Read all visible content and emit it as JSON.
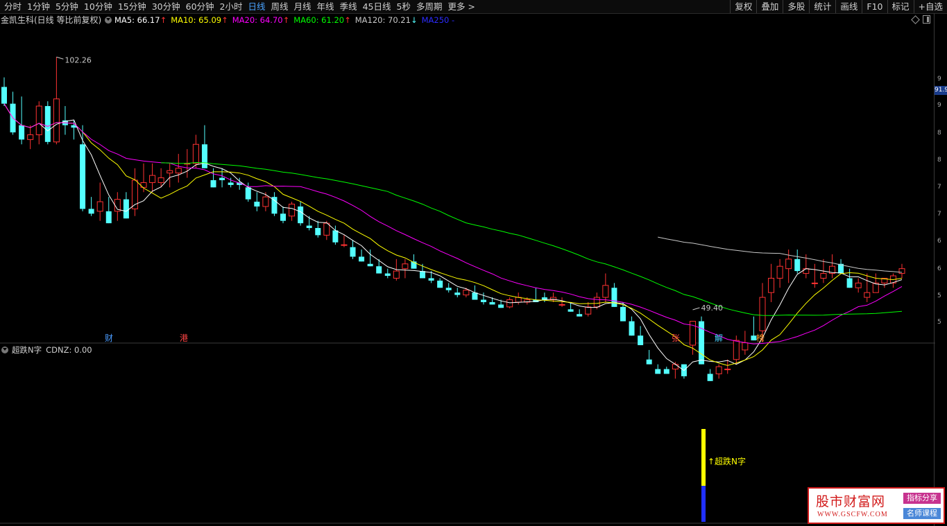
{
  "toolbar": {
    "periods": [
      "分时",
      "1分钟",
      "5分钟",
      "10分钟",
      "15分钟",
      "30分钟",
      "60分钟",
      "2小时",
      "日线",
      "周线",
      "月线",
      "年线",
      "季线",
      "45日线",
      "5秒",
      "多周期",
      "更多 >"
    ],
    "active_period": "日线",
    "right_buttons": [
      "复权",
      "叠加",
      "多股",
      "统计",
      "画线",
      "F10",
      "标记",
      "+自选"
    ]
  },
  "main_legend": {
    "stock_name": "金凯生科(日线 等比前复权)",
    "ma5": "MA5: 66.17",
    "ma10": "MA10: 65.09",
    "ma20": "MA20: 64.70",
    "ma60": "MA60: 61.20",
    "ma120": "MA120: 70.21",
    "ma250": "MA250 -",
    "up_arrow": "↑",
    "down_arrow": "↓",
    "colors": {
      "ma5": "#ffffff",
      "ma10": "#ffff00",
      "ma20": "#ff00ff",
      "ma60": "#00ff00",
      "ma120": "#c8c8c8",
      "ma250": "#2c2cff",
      "up": "#ff3232",
      "down": "#54ffff"
    }
  },
  "annotations": {
    "high_label": "102.26",
    "low_label": "49.40",
    "markers": [
      {
        "text": "财",
        "color": "#4a9cff"
      },
      {
        "text": "港",
        "color": "#ff4444"
      },
      {
        "text": "张",
        "color": "#ff4444"
      },
      {
        "text": "解",
        "color": "#4ad2ff"
      },
      {
        "text": "榜",
        "color": "#ff9a2a"
      }
    ]
  },
  "axis": {
    "labels": [
      "9",
      "9",
      "8",
      "8",
      "7",
      "7",
      "6",
      "6",
      "5",
      "5"
    ],
    "current_price_tag": "91.9"
  },
  "indicator": {
    "name": "超跌N字",
    "value_text": "CDNZ: 0.00",
    "signal_label": "↑超跌N字"
  },
  "watermark": {
    "title": "股市财富网",
    "url": "WWW.GSCFW.COM",
    "tag1": "指标分享",
    "tag2": "名师课程"
  },
  "chart_data": {
    "type": "candlestick",
    "title": "金凯生科(日线 等比前复权)",
    "high": 102.26,
    "low": 49.4,
    "series_names": [
      "MA5",
      "MA10",
      "MA20",
      "MA60",
      "MA120",
      "MA250"
    ],
    "ma_values_latest": {
      "MA5": 66.17,
      "MA10": 65.09,
      "MA20": 64.7,
      "MA60": 61.2,
      "MA120": 70.21
    },
    "candles_ohlc_approx": [
      [
        96,
        98,
        92,
        92.5
      ],
      [
        92.5,
        95,
        86,
        86.5
      ],
      [
        88,
        94,
        84,
        85
      ],
      [
        85,
        88,
        83,
        86
      ],
      [
        86,
        93,
        84,
        92
      ],
      [
        92,
        93,
        84,
        84.5
      ],
      [
        84.5,
        102.26,
        84,
        93.5
      ],
      [
        89,
        92,
        86,
        88
      ],
      [
        88,
        89,
        85,
        87.5
      ],
      [
        84,
        88,
        70,
        70.5
      ],
      [
        70.5,
        73,
        69,
        69.5
      ],
      [
        70,
        76,
        68,
        72
      ],
      [
        70,
        73,
        67.5,
        67.5
      ],
      [
        70,
        74,
        68,
        72.5
      ],
      [
        72.5,
        74,
        68.5,
        68.5
      ],
      [
        70.5,
        79,
        69,
        76.5
      ],
      [
        75,
        80,
        74,
        76
      ],
      [
        76,
        80,
        74,
        77.5
      ],
      [
        76,
        79,
        75,
        77
      ],
      [
        78,
        80,
        75,
        78.5
      ],
      [
        78,
        82,
        76,
        79
      ],
      [
        80,
        83,
        77,
        80
      ],
      [
        80,
        86,
        79,
        84
      ],
      [
        84,
        88,
        79,
        79
      ],
      [
        76.5,
        79,
        75,
        75
      ],
      [
        77,
        79,
        75,
        76.5
      ],
      [
        76,
        77,
        75,
        75.5
      ],
      [
        76,
        77,
        74.5,
        75.5
      ],
      [
        75,
        76,
        72,
        72.5
      ],
      [
        72,
        74,
        70,
        71
      ],
      [
        71,
        74,
        70,
        73
      ],
      [
        73,
        74,
        69,
        69.5
      ],
      [
        69.5,
        71,
        67.5,
        68
      ],
      [
        69,
        72,
        68,
        71.5
      ],
      [
        71,
        72,
        67,
        67.5
      ],
      [
        67,
        69,
        66,
        66.5
      ],
      [
        66.5,
        68,
        64.5,
        65
      ],
      [
        65,
        68,
        64,
        67.5
      ],
      [
        66,
        67,
        63,
        63.5
      ],
      [
        63,
        65,
        62.5,
        63
      ],
      [
        62.5,
        64,
        60,
        60.5
      ],
      [
        60.5,
        62,
        59.5,
        59.5
      ],
      [
        59,
        62,
        58.5,
        58.5
      ],
      [
        58.5,
        60,
        57,
        57
      ],
      [
        57,
        58,
        56,
        56.5
      ],
      [
        56,
        60,
        55.5,
        57.5
      ],
      [
        58,
        60,
        56,
        59
      ],
      [
        59.5,
        61,
        58,
        58
      ],
      [
        57.5,
        59,
        56,
        56
      ],
      [
        56,
        57.5,
        55,
        55.5
      ],
      [
        55.5,
        56,
        54,
        54
      ],
      [
        54,
        55,
        53,
        53.5
      ],
      [
        53,
        54,
        52,
        52.5
      ],
      [
        52.5,
        54,
        52,
        53.5
      ],
      [
        53,
        54.5,
        51.5,
        51.5
      ],
      [
        51.5,
        53,
        50.5,
        51
      ],
      [
        51,
        52,
        50.5,
        50.5
      ],
      [
        50.5,
        51.5,
        49.8,
        49.8
      ],
      [
        50,
        52,
        49.7,
        51.5
      ],
      [
        51,
        53,
        50.5,
        52
      ],
      [
        51,
        52,
        50.5,
        51.5
      ],
      [
        51.5,
        54,
        51,
        51
      ],
      [
        52,
        53,
        51,
        51.5
      ],
      [
        51.5,
        53,
        51,
        52
      ],
      [
        50.5,
        52,
        50,
        50.5
      ],
      [
        49.5,
        51,
        49,
        49
      ],
      [
        48.5,
        49.5,
        48,
        48
      ],
      [
        48.5,
        51,
        48,
        50
      ],
      [
        50,
        53,
        49.5,
        52
      ],
      [
        52,
        57,
        51,
        54.5
      ],
      [
        54,
        55,
        50,
        50
      ],
      [
        50,
        51,
        47,
        47
      ],
      [
        47,
        48,
        44,
        44
      ],
      [
        44,
        46,
        42,
        42
      ],
      [
        39,
        41,
        38,
        38
      ],
      [
        37,
        38,
        36,
        36
      ],
      [
        37,
        37.5,
        36,
        36
      ],
      [
        37,
        38.5,
        35,
        38
      ],
      [
        38,
        38,
        35,
        35.5
      ],
      [
        42,
        47,
        40,
        47
      ],
      [
        47,
        48,
        38,
        38
      ],
      [
        36,
        37,
        34.5,
        34.5
      ],
      [
        36,
        38,
        35,
        37.5
      ],
      [
        37,
        39,
        36,
        37
      ],
      [
        39,
        44,
        38,
        43
      ],
      [
        41,
        45,
        40,
        42.5
      ],
      [
        44,
        48,
        43,
        43
      ],
      [
        45,
        55,
        42.7,
        52
      ],
      [
        53,
        59,
        51,
        56
      ],
      [
        56,
        60,
        54,
        58.5
      ],
      [
        58,
        62,
        55,
        60
      ],
      [
        60,
        62,
        57,
        57.5
      ],
      [
        57,
        61,
        56,
        58
      ],
      [
        55,
        59,
        54,
        55
      ],
      [
        56,
        60,
        55,
        57
      ],
      [
        57,
        61,
        56,
        58.5
      ],
      [
        59,
        60,
        57,
        57
      ],
      [
        56,
        58,
        54,
        54
      ],
      [
        54,
        56,
        53,
        55
      ],
      [
        52,
        57,
        51,
        53
      ],
      [
        53,
        57,
        53,
        55
      ],
      [
        55,
        56,
        54,
        56
      ],
      [
        55,
        57,
        54,
        56.5
      ],
      [
        57,
        59,
        56,
        58
      ]
    ]
  }
}
